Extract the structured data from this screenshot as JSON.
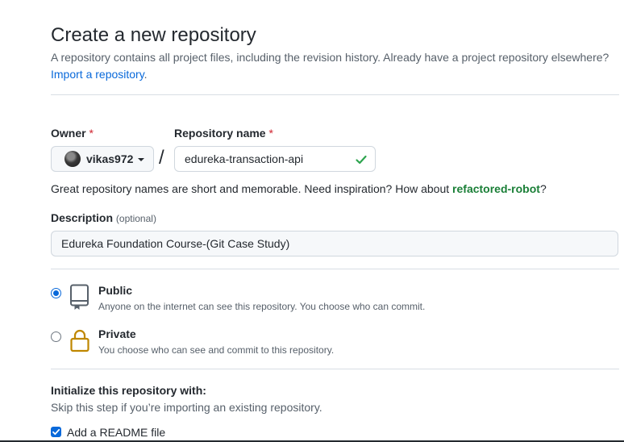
{
  "header": {
    "title": "Create a new repository",
    "subtitle": "A repository contains all project files, including the revision history. Already have a project repository elsewhere?",
    "import_link": "Import a repository",
    "import_suffix": "."
  },
  "owner": {
    "label": "Owner",
    "required_mark": "*",
    "value": "vikas972"
  },
  "separator": "/",
  "repo_name": {
    "label": "Repository name",
    "required_mark": "*",
    "value": "edureka-transaction-api",
    "valid": true
  },
  "name_hint": {
    "text": "Great repository names are short and memorable. Need inspiration? How about ",
    "suggestion": "refactored-robot",
    "suffix": "?"
  },
  "description": {
    "label": "Description",
    "optional": "(optional)",
    "value": "Edureka Foundation Course-(Git Case Study)"
  },
  "visibility": {
    "selected": "public",
    "options": [
      {
        "id": "public",
        "title": "Public",
        "desc": "Anyone on the internet can see this repository. You choose who can commit."
      },
      {
        "id": "private",
        "title": "Private",
        "desc": "You choose who can see and commit to this repository."
      }
    ]
  },
  "initialize": {
    "title": "Initialize this repository with:",
    "subtitle": "Skip this step if you’re importing an existing repository.",
    "readme": {
      "label": "Add a README file",
      "checked": true
    }
  },
  "colors": {
    "link": "#0969da",
    "success": "#1a7f37",
    "required": "#cf222e",
    "muted": "#57606a",
    "lock": "#bf8700"
  },
  "icons": {
    "repo": "repo-icon",
    "lock": "lock-icon",
    "check": "check-icon",
    "caret": "caret-down-icon"
  }
}
